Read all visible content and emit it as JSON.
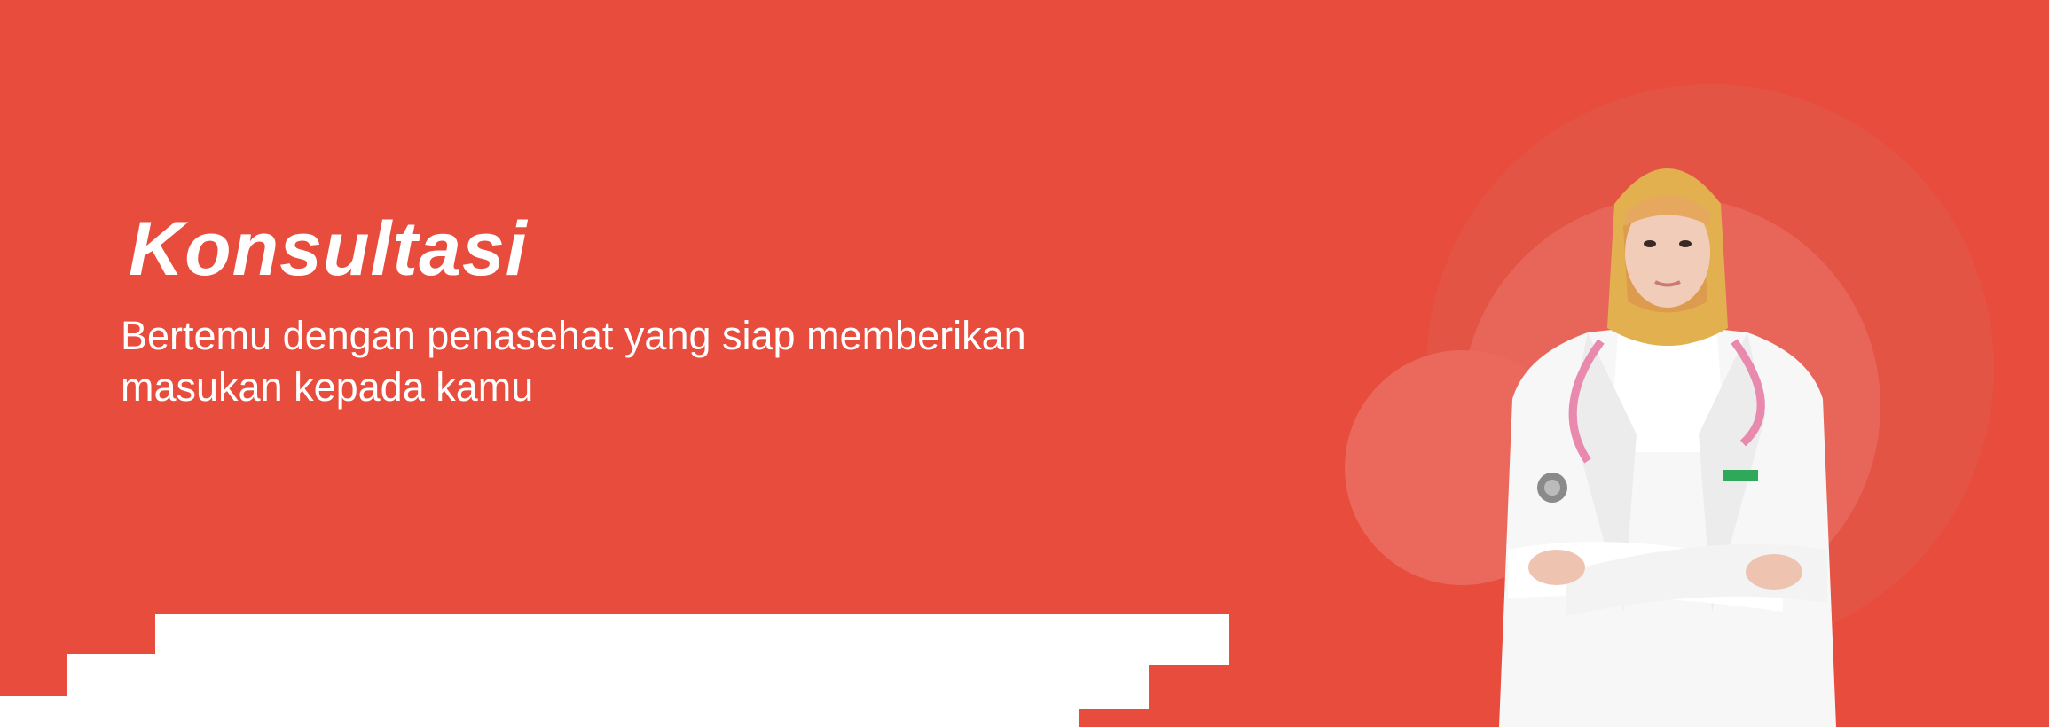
{
  "hero": {
    "title": "Konsultasi",
    "subtitle_line1": "Bertemu dengan penasehat yang siap memberikan",
    "subtitle_line2": "masukan kepada kamu"
  },
  "colors": {
    "background": "#e84c3d",
    "circle_outer": "#e45445",
    "circle_mid": "#e8655a",
    "text": "#ffffff"
  },
  "image": {
    "subject": "doctor-in-hijab-with-stethoscope"
  }
}
